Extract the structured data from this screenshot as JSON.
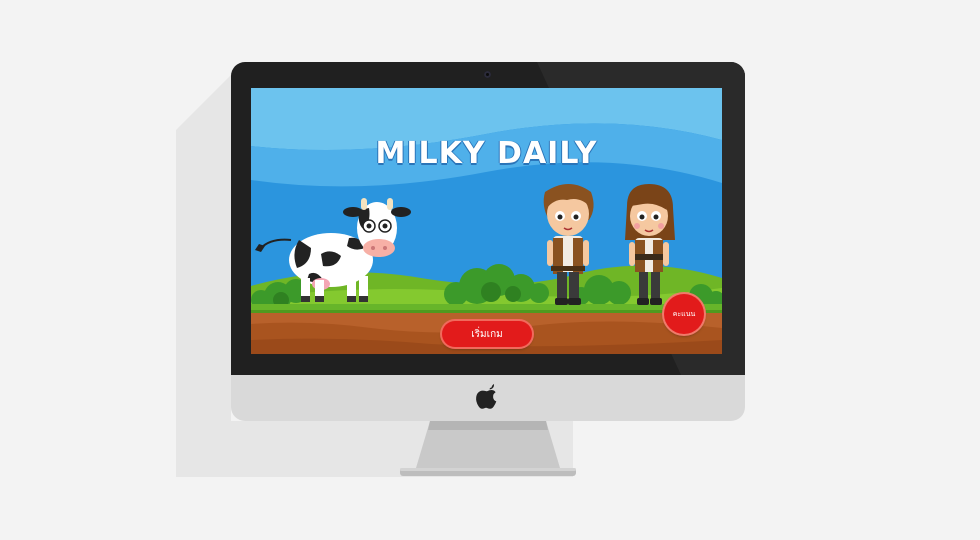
{
  "game": {
    "title": "MILKY DAILY",
    "start_button_label": "เริ่มเกม",
    "score_button_label": "คะแนน"
  },
  "icons": {
    "device_logo": "apple-logo-icon"
  },
  "colors": {
    "sky": "#4fa9e6",
    "grass": "#78c22a",
    "dirt": "#b8612b",
    "button_red": "#e21b1b",
    "bezel": "#202020",
    "chin": "#d9d9d9",
    "background": "#f3f3f3"
  }
}
